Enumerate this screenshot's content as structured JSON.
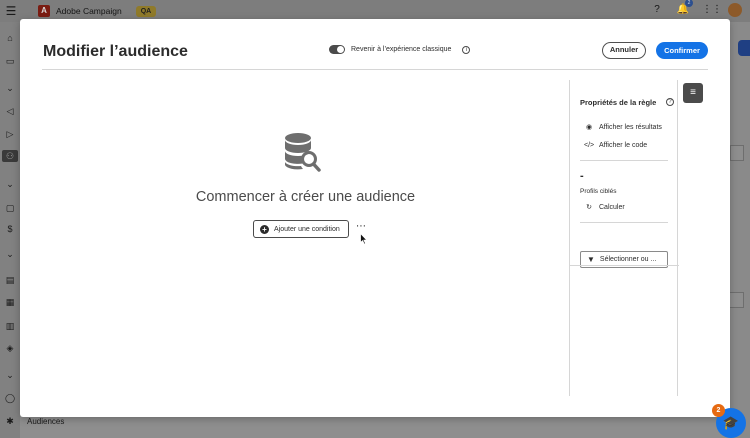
{
  "app": {
    "name": "Adobe Campaign",
    "env_badge": "QA",
    "notifications_count": "2",
    "bottom_nav_label": "Audiences"
  },
  "modal": {
    "title": "Modifier l’audience",
    "classic_toggle_label": "Revenir à l’expérience classique",
    "cancel_label": "Annuler",
    "confirm_label": "Confirmer"
  },
  "canvas": {
    "empty_title": "Commencer à créer une audience",
    "add_condition_label": "Ajouter une condition",
    "more_label": "⋯"
  },
  "rule_properties": {
    "title": "Propriétés de la règle",
    "show_results_label": "Afficher les résultats",
    "show_code_label": "Afficher le code",
    "count_value": "-",
    "targeted_profiles_label": "Profils ciblés",
    "compute_label": "Calculer",
    "select_or_label": "Sélectionner ou ..."
  },
  "help": {
    "badge_count": "2"
  },
  "colors": {
    "accent": "#1473e6",
    "badge": "#e66a12"
  },
  "icons": {
    "menu": "hamburger-icon",
    "help": "question-icon",
    "bell": "bell-icon",
    "apps": "grid-icon",
    "empty_state": "database-search-icon",
    "add": "plus-circle-icon",
    "eye": "eye-icon",
    "code": "code-icon",
    "refresh": "refresh-icon",
    "filter": "filter-icon",
    "settings": "sliders-icon",
    "help_badge": "graduation-cap-icon"
  }
}
